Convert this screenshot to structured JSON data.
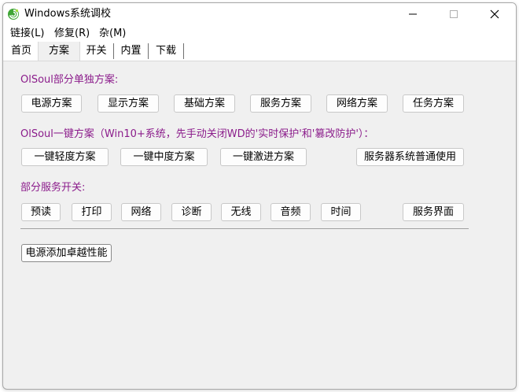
{
  "window": {
    "title": "Windows系统调校",
    "app_icon": "green-swirl-icon",
    "controls": [
      "minimize-icon",
      "maximize-icon",
      "close-icon"
    ]
  },
  "menu": {
    "items": [
      {
        "label": "链接(L)"
      },
      {
        "label": "修复(R)"
      },
      {
        "label": "杂(M)"
      }
    ]
  },
  "tabs": {
    "active": "方案",
    "items": [
      {
        "label": "首页"
      },
      {
        "label": "方案"
      },
      {
        "label": "开关"
      },
      {
        "label": "内置"
      },
      {
        "label": "下载"
      }
    ]
  },
  "sections": {
    "single": {
      "label": "OlSoul部分单独方案:",
      "buttons": [
        "电源方案",
        "显示方案",
        "基础方案",
        "服务方案",
        "网络方案",
        "任务方案"
      ]
    },
    "onekey": {
      "label": "OlSoul一键方案（Win10+系统，先手动关闭WD的'实时保护'和'篡改防护'）：",
      "buttons": [
        "一键轻度方案",
        "一键中度方案",
        "一键激进方案",
        "服务器系统普通使用"
      ]
    },
    "services": {
      "label": "部分服务开关:",
      "buttons": [
        "预读",
        "打印",
        "网络",
        "诊断",
        "无线",
        "音频",
        "时间",
        "服务界面"
      ]
    },
    "power": {
      "button": "电源添加卓越性能"
    }
  },
  "colors": {
    "section_label": "#8b1c8b",
    "window_bg": "#f0f0f0",
    "icon_green": "#3fa535"
  }
}
